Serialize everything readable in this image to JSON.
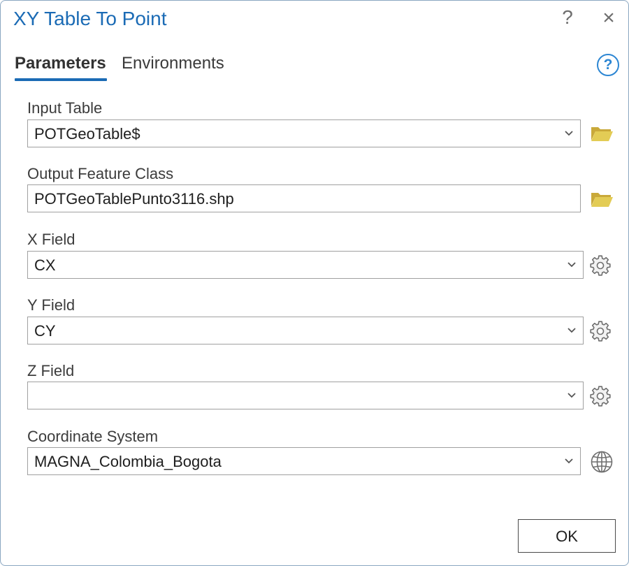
{
  "window": {
    "title": "XY Table To Point",
    "help_symbol": "?",
    "close_symbol": "×"
  },
  "tabs": [
    {
      "label": "Parameters",
      "active": true
    },
    {
      "label": "Environments",
      "active": false
    }
  ],
  "help_icon": {
    "symbol": "?",
    "icon": "help-circle-icon",
    "color": "#2c86d3"
  },
  "fields": {
    "input_table": {
      "label": "Input Table",
      "value": "POTGeoTable$",
      "icon": "folder-icon"
    },
    "output_feature_class": {
      "label": "Output Feature Class",
      "value": "POTGeoTablePunto3116.shp",
      "icon": "folder-icon"
    },
    "x_field": {
      "label": "X Field",
      "value": "CX",
      "icon": "gear-icon"
    },
    "y_field": {
      "label": "Y Field",
      "value": "CY",
      "icon": "gear-icon"
    },
    "z_field": {
      "label": "Z Field",
      "value": "",
      "icon": "gear-icon"
    },
    "coordinate_system": {
      "label": "Coordinate System",
      "value": "MAGNA_Colombia_Bogota",
      "icon": "globe-icon"
    }
  },
  "footer": {
    "ok_label": "OK"
  },
  "colors": {
    "accent": "#1b6bb5",
    "folder": "#d9c04a",
    "icon_gray": "#6e6e6e"
  }
}
